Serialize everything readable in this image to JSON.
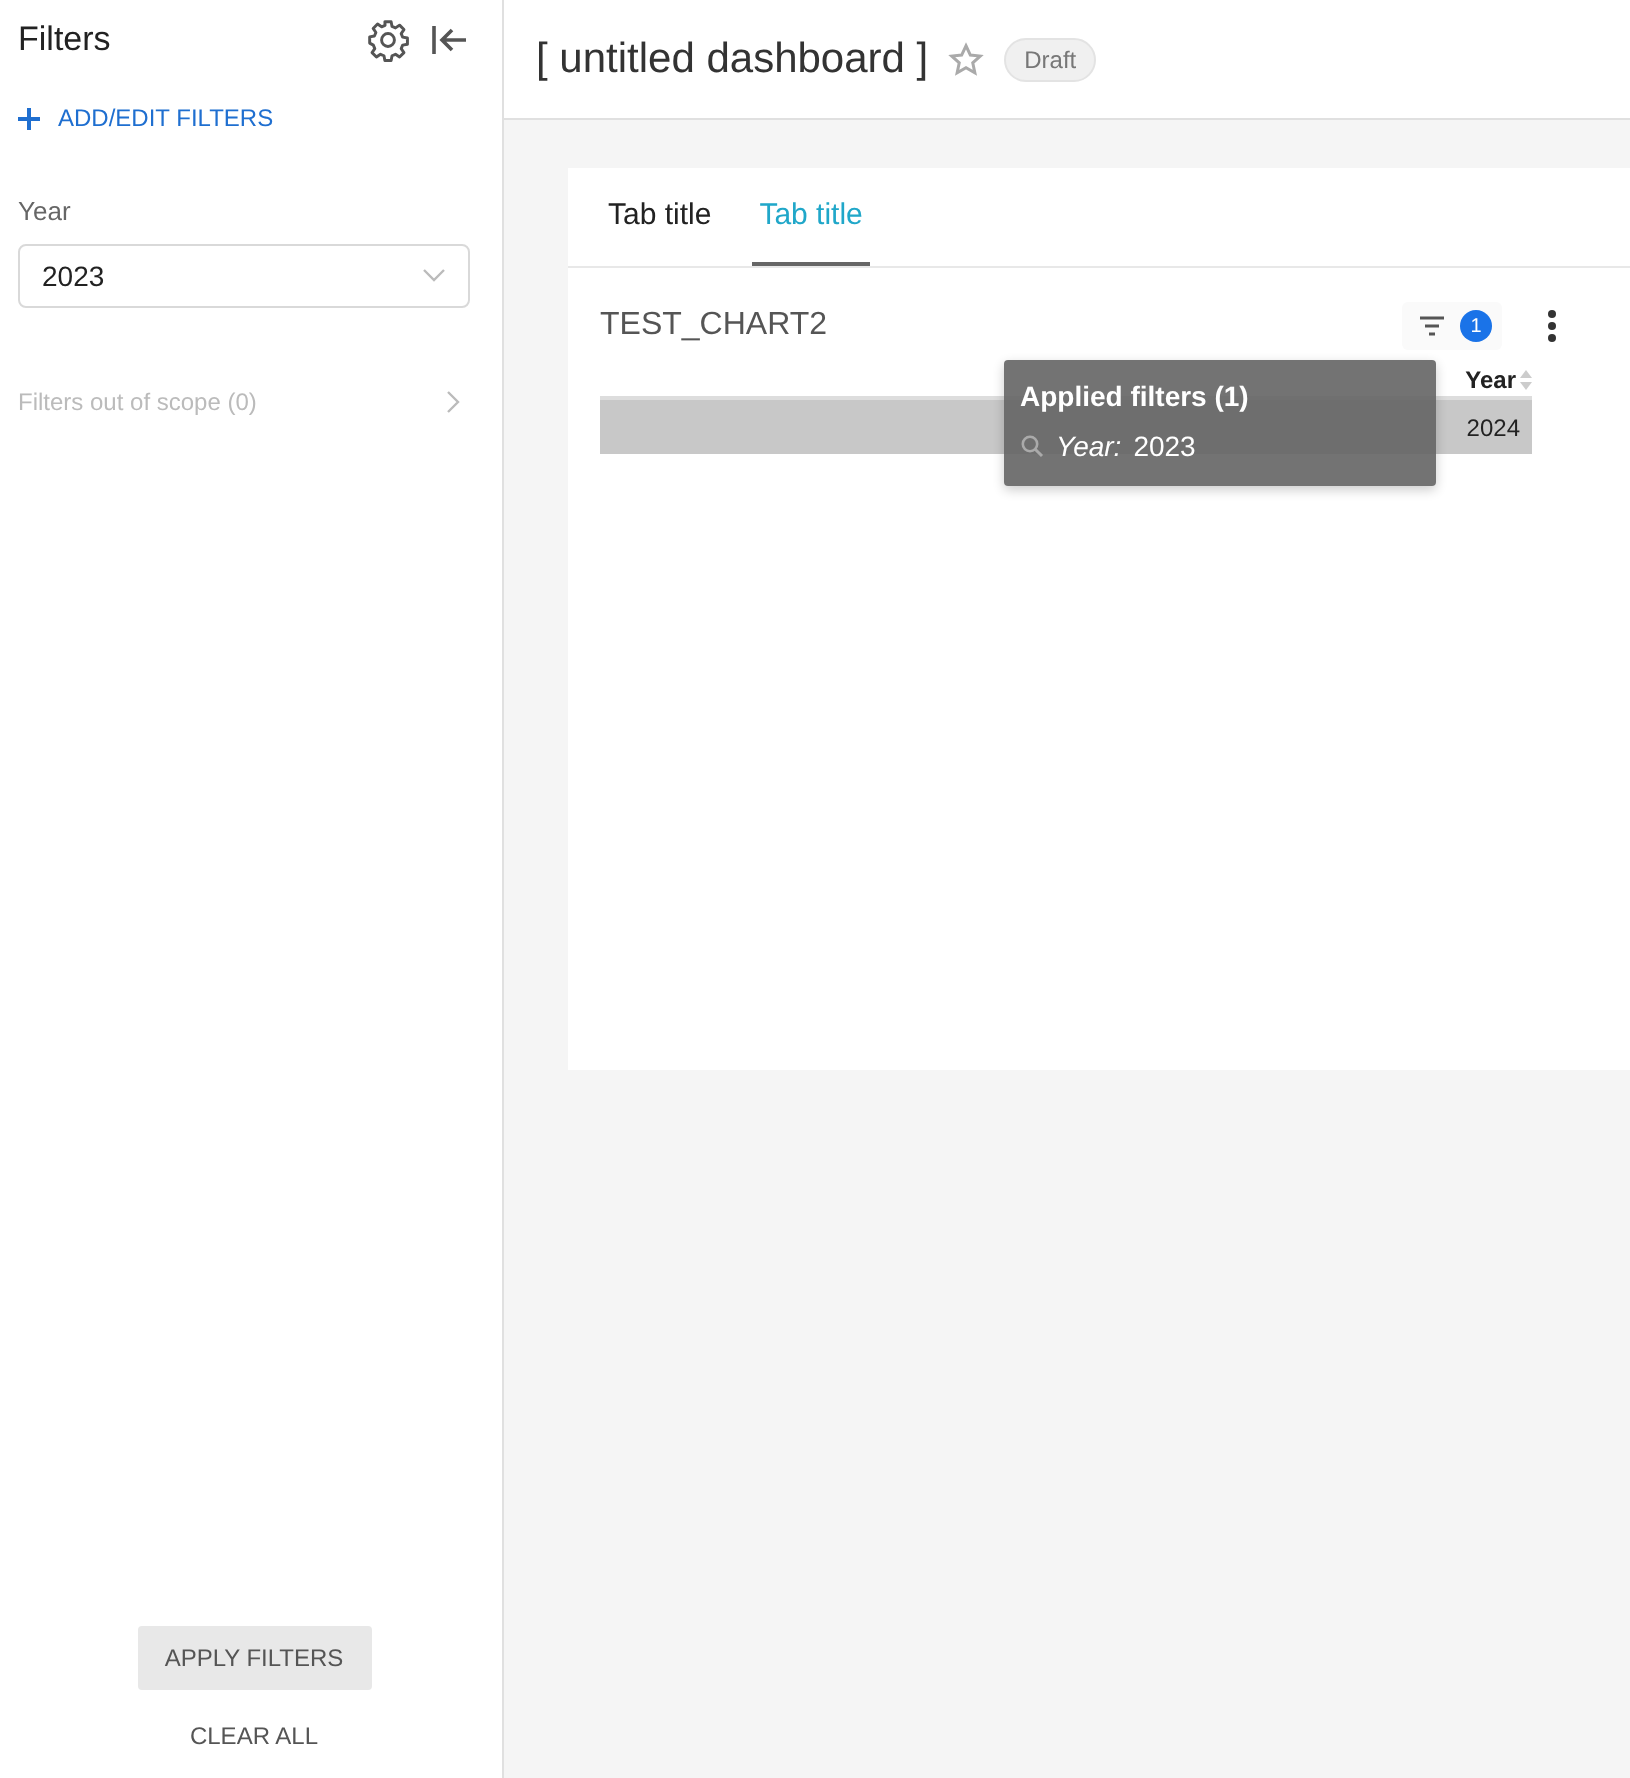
{
  "sidebar": {
    "title": "Filters",
    "add_link": "ADD/EDIT FILTERS",
    "filters": [
      {
        "label": "Year",
        "value": "2023"
      }
    ],
    "out_of_scope": "Filters out of scope (0)",
    "apply_button": "APPLY FILTERS",
    "clear_button": "CLEAR ALL"
  },
  "header": {
    "title": "[ untitled dashboard ]",
    "starred": false,
    "badge": "Draft"
  },
  "tabs": [
    {
      "label": "Tab title",
      "selected": false
    },
    {
      "label": "Tab title",
      "selected": true
    }
  ],
  "chart": {
    "title": "TEST_CHART2",
    "filter_count": "1",
    "table": {
      "columns": [
        "Year"
      ],
      "rows": [
        [
          "2024"
        ]
      ]
    },
    "tooltip": {
      "title": "Applied filters (1)",
      "items": [
        {
          "label": "Year:",
          "value": "2023"
        }
      ]
    }
  }
}
